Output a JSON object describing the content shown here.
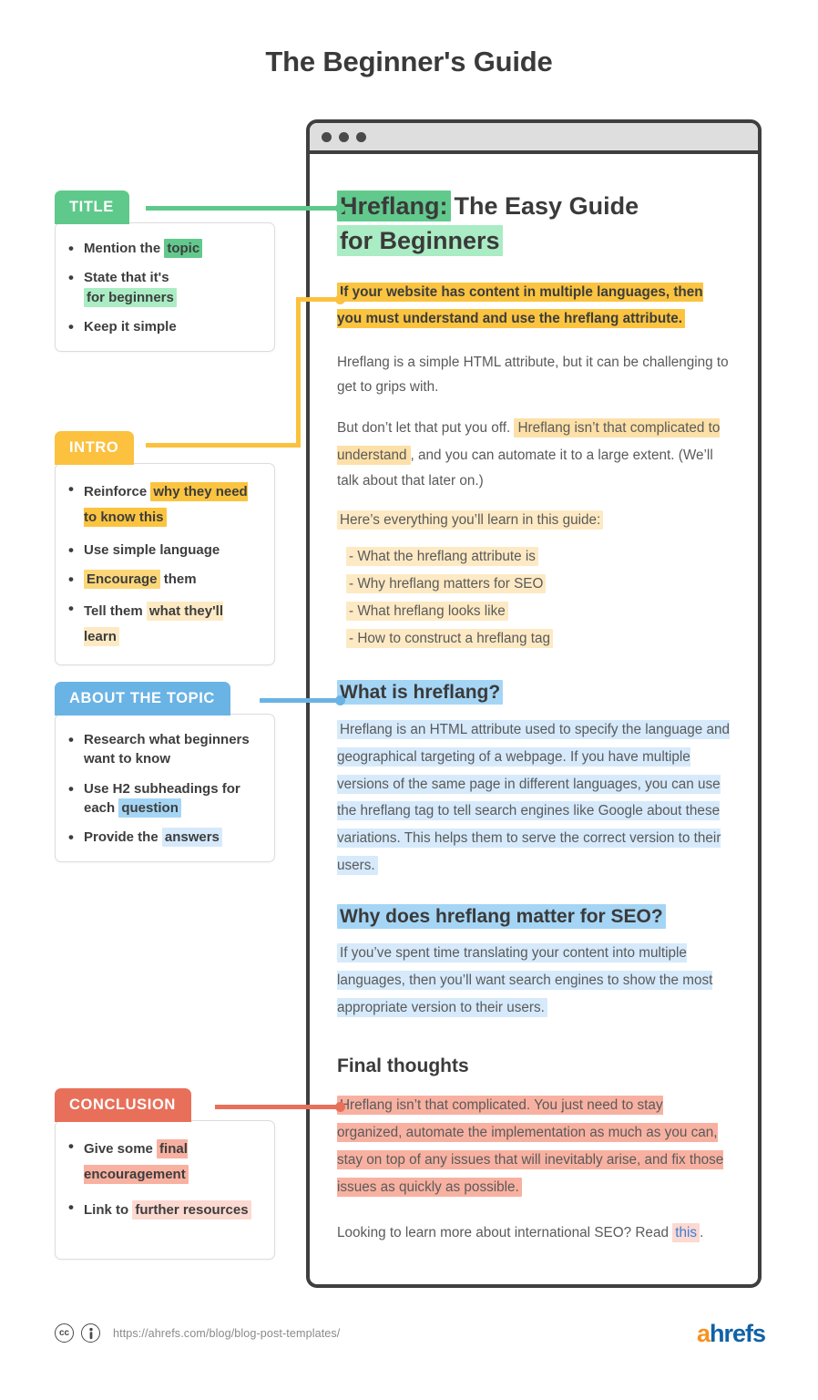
{
  "header": {
    "title": "The Beginner's Guide"
  },
  "colors": {
    "green_tab": "#5ec98b",
    "green_strong": "#62c98d",
    "green_light": "#aaecc4",
    "yellow_tab": "#fbc13f",
    "yellow_strong": "#fbc440",
    "yellow_mid": "#fcd779",
    "yellow_light": "#fdeac4",
    "blue_tab": "#6ab3e5",
    "blue_strong": "#a5d5f5",
    "blue_light": "#d6eafb",
    "red_tab": "#e8705a",
    "red_strong": "#f8b1a1",
    "red_light": "#fcd9d1",
    "link": "#3b7dd8"
  },
  "browser": {
    "dots": [
      "dot-1",
      "dot-2",
      "dot-3"
    ]
  },
  "article": {
    "h1_highlight": "Hreflang:",
    "h1_rest_line1": "The Easy Guide",
    "h1_rest_line2": "for Beginners",
    "lead": "If your website has content in multiple languages, then you must understand and use the hreflang attribute.",
    "p1": "Hreflang is a simple HTML attribute, but it can be challenging to get to grips with.",
    "p2_pre": "But don’t let that put you off. ",
    "p2_hl": "Hreflang isn’t that complicated to understand",
    "p2_post": ", and you can automate it to a large extent. (We’ll talk about that later on.)",
    "p3": "Here’s everything you’ll learn in this guide:",
    "toc": [
      "- What the hreflang attribute is",
      "- Why hreflang matters for SEO",
      "- What hreflang looks like",
      "- How to construct a hreflang tag"
    ],
    "h2_a": "What is hreflang?",
    "p4": "Hreflang is an HTML attribute used to specify the language and geographical targeting of a webpage. If you have multiple versions of the same page in different languages, you can use the hreflang tag to tell search engines like Google about these variations. This helps them to serve the correct version to their users.",
    "h2_b": "Why does hreflang matter for SEO?",
    "p5": "If you’ve spent time translating your content into multiple languages, then you’ll want search engines to show the most appropriate version to their users.",
    "h2_c": "Final thoughts",
    "p6": "Hreflang isn’t that complicated. You just need to stay organized, automate the implementation as much as you can, stay on top of any issues that will inevitably arise, and fix those issues as quickly as possible.",
    "p7_pre": "Looking to learn more about international SEO? Read ",
    "p7_link": "this",
    "p7_post": "."
  },
  "panels": [
    {
      "tab": "TITLE",
      "items": [
        {
          "pre": "Mention the ",
          "hl": "topic",
          "post": "",
          "shade": "strong"
        },
        {
          "pre": "State that it's ",
          "hl": "for beginners",
          "post": "",
          "shade": "light"
        },
        {
          "pre": "Keep it simple",
          "hl": "",
          "post": "",
          "shade": "none"
        }
      ]
    },
    {
      "tab": "INTRO",
      "items": [
        {
          "pre": "Reinforce ",
          "hl": "why they need to know this",
          "post": "",
          "shade": "strong"
        },
        {
          "pre": "Use simple language",
          "hl": "",
          "post": "",
          "shade": "none"
        },
        {
          "pre": "",
          "hl": "Encourage",
          "post": " them",
          "shade": "mid"
        },
        {
          "pre": "Tell them ",
          "hl": "what they'll learn",
          "post": "",
          "shade": "light"
        }
      ]
    },
    {
      "tab": "ABOUT THE TOPIC",
      "items": [
        {
          "pre": "Research what beginners want to know",
          "hl": "",
          "post": "",
          "shade": "none"
        },
        {
          "pre": "Use H2 subheadings for each ",
          "hl": "question",
          "post": "",
          "shade": "strong"
        },
        {
          "pre": "Provide the ",
          "hl": "answers",
          "post": "",
          "shade": "light"
        }
      ]
    },
    {
      "tab": "CONCLUSION",
      "items": [
        {
          "pre": "Give some ",
          "hl": "final encouragement",
          "post": "",
          "shade": "strong"
        },
        {
          "pre": "Link to ",
          "hl": "further resources",
          "post": "",
          "shade": "light"
        }
      ]
    }
  ],
  "footer": {
    "cc_icon": "creative-commons-icon",
    "by_icon": "attribution-icon",
    "cc_label": "cc",
    "by_label": "i",
    "url": "https://ahrefs.com/blog/blog-post-templates/",
    "logo_a": "a",
    "logo_rest": "hrefs"
  }
}
